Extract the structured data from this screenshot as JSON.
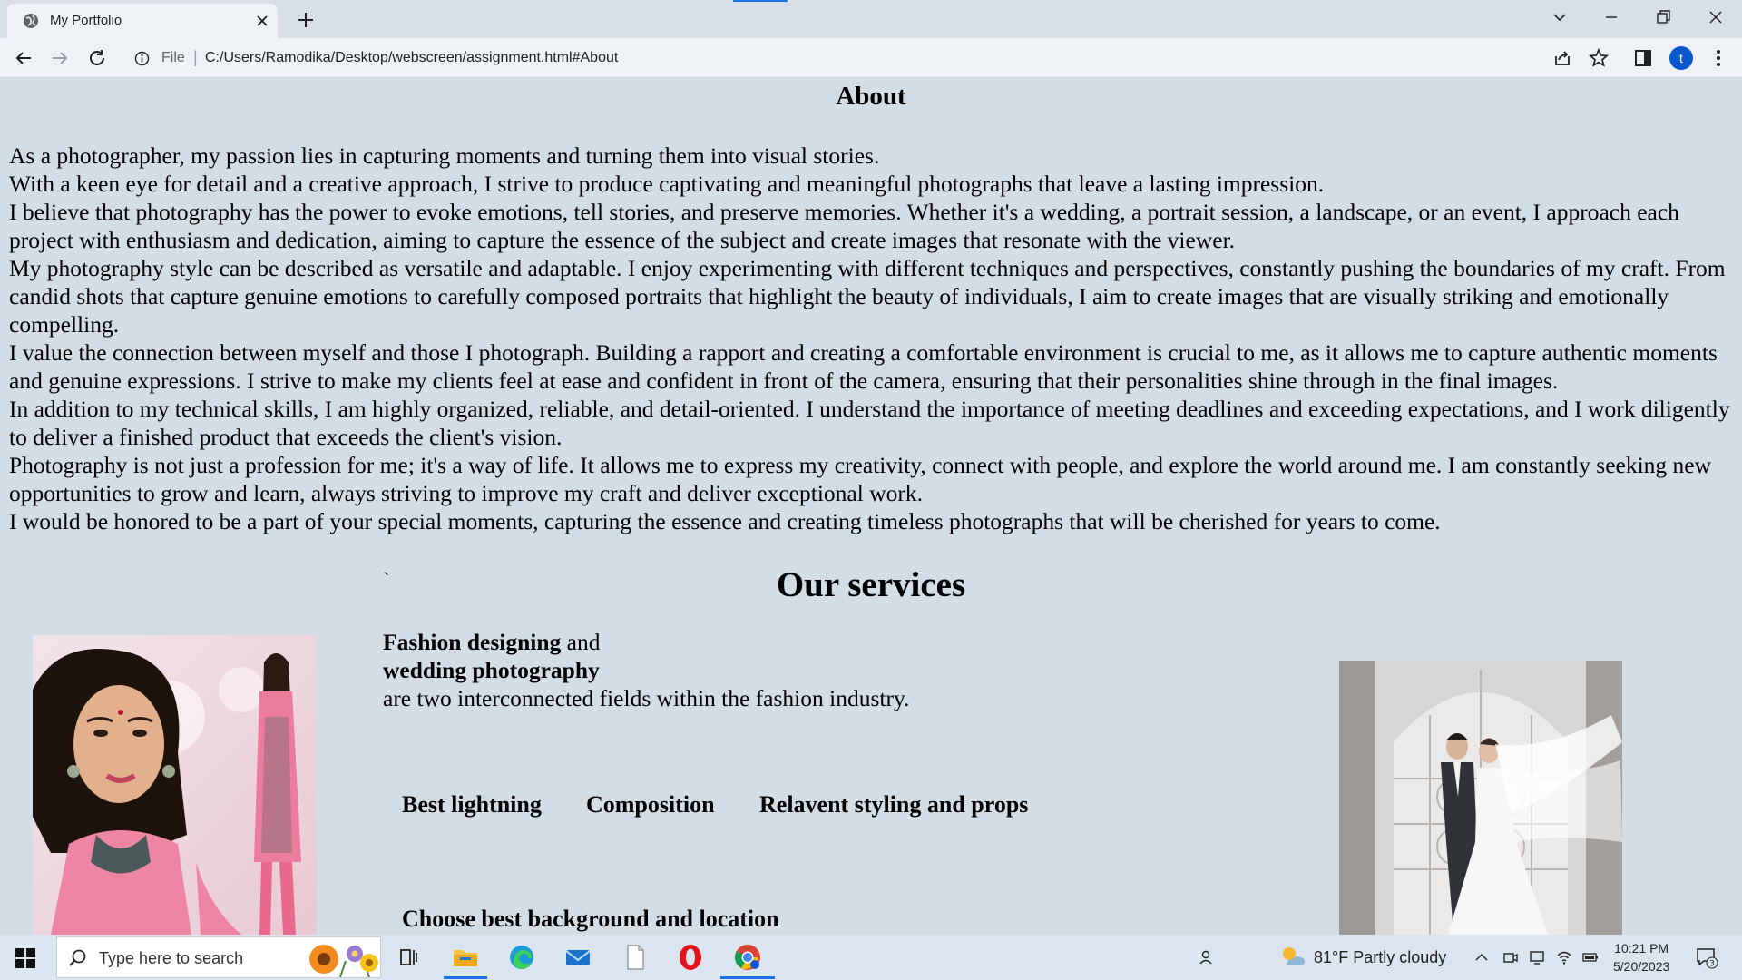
{
  "browser": {
    "tab_title": "My Portfolio",
    "address_scheme": "File",
    "address_url": "C:/Users/Ramodika/Desktop/webscreen/assignment.html#About",
    "profile_initial": "t"
  },
  "about": {
    "heading": "About",
    "paragraphs": [
      "As a photographer, my passion lies in capturing moments and turning them into visual stories.",
      "With a keen eye for detail and a creative approach, I strive to produce captivating and meaningful photographs that leave a lasting impression.",
      "I believe that photography has the power to evoke emotions, tell stories, and preserve memories. Whether it's a wedding, a portrait session, a landscape, or an event, I approach each project with enthusiasm and dedication, aiming to capture the essence of the subject and create images that resonate with the viewer.",
      "My photography style can be described as versatile and adaptable. I enjoy experimenting with different techniques and perspectives, constantly pushing the boundaries of my craft. From candid shots that capture genuine emotions to carefully composed portraits that highlight the beauty of individuals, I aim to create images that are visually striking and emotionally compelling.",
      "I value the connection between myself and those I photograph. Building a rapport and creating a comfortable environment is crucial to me, as it allows me to capture authentic moments and genuine expressions. I strive to make my clients feel at ease and confident in front of the camera, ensuring that their personalities shine through in the final images.",
      "In addition to my technical skills, I am highly organized, reliable, and detail-oriented. I understand the importance of meeting deadlines and exceeding expectations, and I work diligently to deliver a finished product that exceeds the client's vision.",
      "Photography is not just a profession for me; it's a way of life. It allows me to express my creativity, connect with people, and explore the world around me. I am constantly seeking new opportunities to grow and learn, always striving to improve my craft and deliver exceptional work.",
      "I would be honored to be a part of your special moments, capturing the essence and creating timeless photographs that will be cherished for years to come."
    ]
  },
  "services": {
    "stray_mark": "`",
    "heading": "Our services",
    "intro_bold_1": "Fashion designing",
    "intro_and": " and",
    "intro_bold_2": "wedding photography",
    "intro_rest": "are two interconnected fields within the fashion industry.",
    "features": [
      "Best lightning",
      "Composition",
      "Relavent styling and props"
    ],
    "feature_background": "Choose best background and location"
  },
  "taskbar": {
    "search_placeholder": "Type here to search",
    "weather": "81°F  Partly cloudy",
    "time": "10:21 PM",
    "date": "5/20/2023",
    "notification_count": "3"
  },
  "colors": {
    "page_background": "#d3dde6",
    "accent": "#1a73e8"
  }
}
